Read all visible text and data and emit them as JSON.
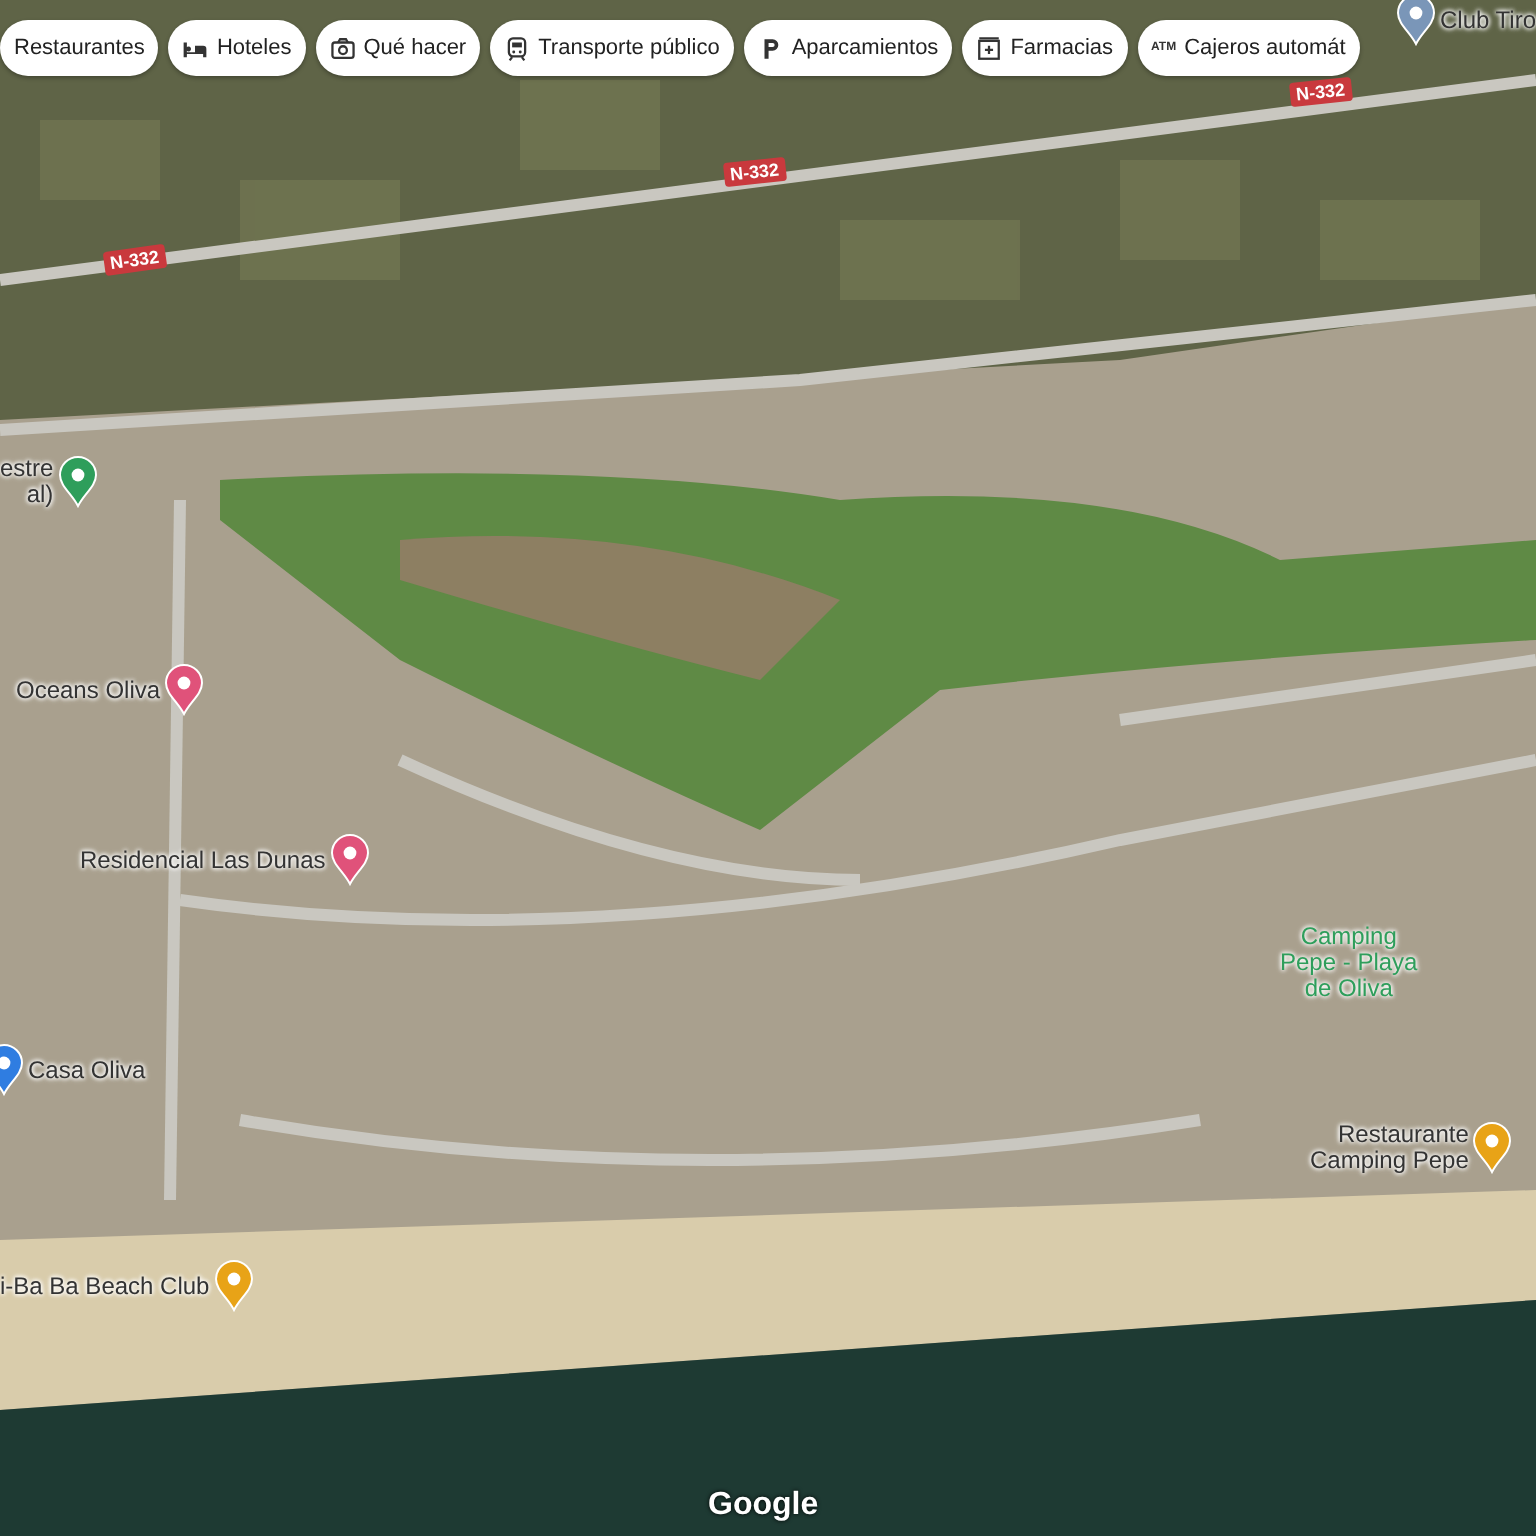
{
  "chips": [
    {
      "label": "Restaurantes"
    },
    {
      "label": "Hoteles"
    },
    {
      "label": "Qué hacer"
    },
    {
      "label": "Transporte público"
    },
    {
      "label": "Aparcamientos"
    },
    {
      "label": "Farmacias"
    },
    {
      "label": "Cajeros automát",
      "icon_text": "ATM"
    }
  ],
  "road_labels": [
    "N-332",
    "N-332",
    "N-332"
  ],
  "places": [
    {
      "name": "Club Tiro",
      "kind": "pin",
      "color": "#7a96b8"
    },
    {
      "name": "estre\nal)",
      "kind": "pin",
      "color": "#2e9e5b"
    },
    {
      "name": "Oceans Oliva",
      "kind": "pin",
      "color": "#e0527a"
    },
    {
      "name": "Residencial Las Dunas",
      "kind": "pin",
      "color": "#e0527a"
    },
    {
      "name": "Casa Oliva",
      "kind": "pin",
      "color": "#2f7de1"
    },
    {
      "name": "i-Ba Ba Beach Club",
      "kind": "pin",
      "color": "#e8a317"
    },
    {
      "name": "Camping\nPepe - Playa\nde Oliva",
      "kind": "area",
      "color": "#2e9e5b"
    },
    {
      "name": "Restaurante\nCamping Pepe",
      "kind": "pin",
      "color": "#e8a317"
    }
  ],
  "attribution": "Google"
}
